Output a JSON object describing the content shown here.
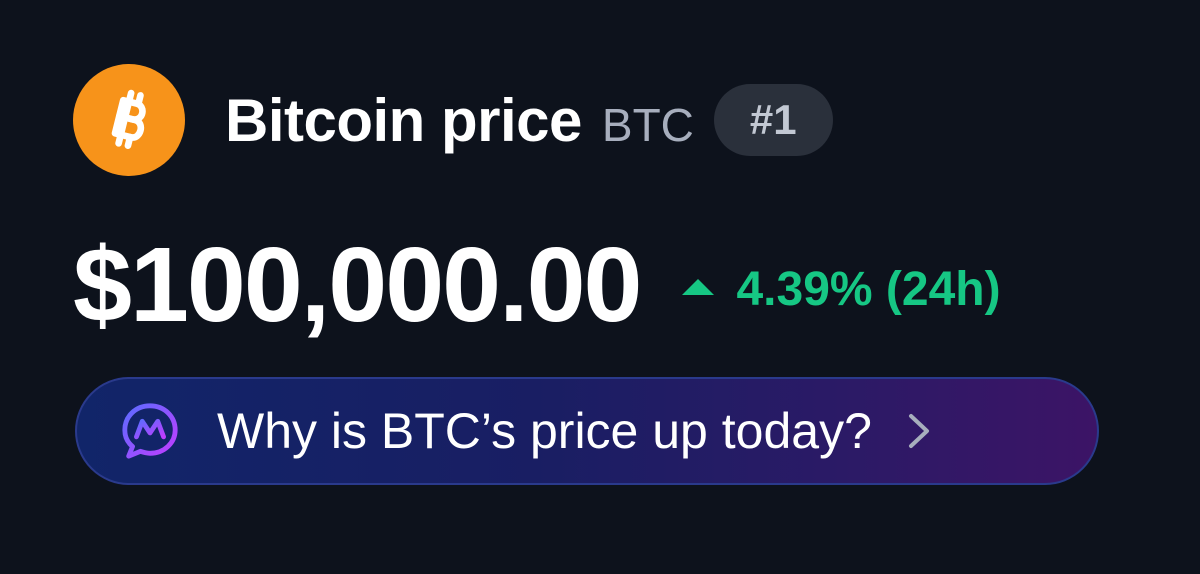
{
  "coin": {
    "name_label": "Bitcoin price",
    "symbol": "BTC",
    "rank": "#1",
    "logo_icon": "bitcoin-icon",
    "logo_color": "#f7931a"
  },
  "price": {
    "value": "$100,000.00",
    "change": "4.39% (24h)",
    "change_direction": "up",
    "change_color": "#16c784"
  },
  "ai_banner": {
    "text": "Why is BTC’s price up today?",
    "icon": "ai-chat-icon",
    "action_icon": "chevron-right-icon"
  }
}
